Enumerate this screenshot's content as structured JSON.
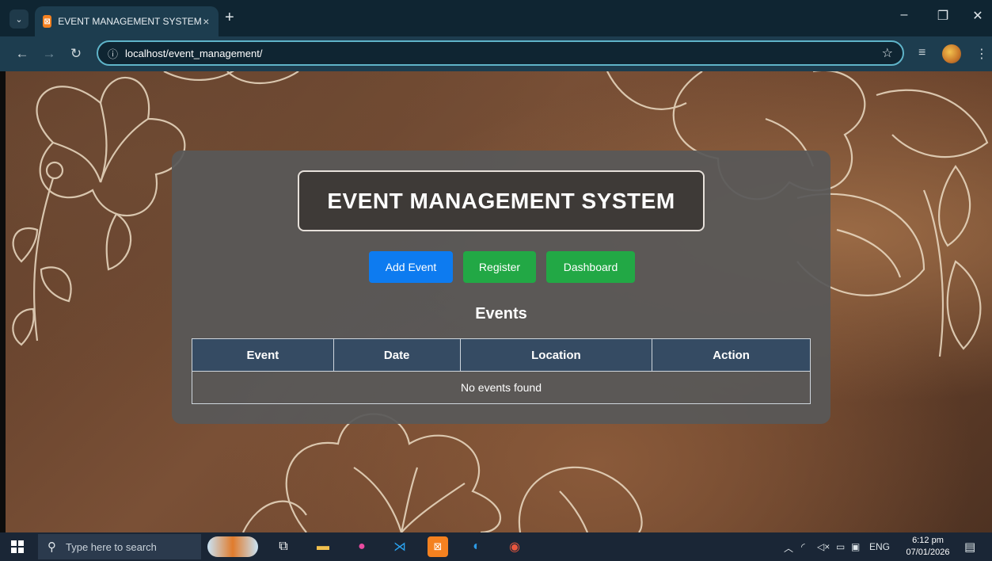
{
  "browser": {
    "tab_title": "EVENT MANAGEMENT SYSTEM",
    "tab_favicon": "xampp-icon",
    "tab_close": "×",
    "new_tab": "+",
    "url": "localhost/event_management/",
    "window_controls": [
      "–",
      "❐",
      "✕"
    ]
  },
  "page": {
    "title": "EVENT MANAGEMENT SYSTEM",
    "buttons": {
      "add_event": "Add Event",
      "register": "Register",
      "dashboard": "Dashboard"
    },
    "events_heading": "Events",
    "table": {
      "headers": [
        "Event",
        "Date",
        "Location",
        "Action"
      ],
      "empty_message": "No events found"
    }
  },
  "taskbar": {
    "search_placeholder": "Type here to search",
    "language": "ENG",
    "time": "6:12 pm",
    "date": "07/01/2026"
  },
  "colors": {
    "add_button": "#0d7bf0",
    "green_button": "#22a845",
    "table_header": "#354b63",
    "card": "#585858"
  }
}
